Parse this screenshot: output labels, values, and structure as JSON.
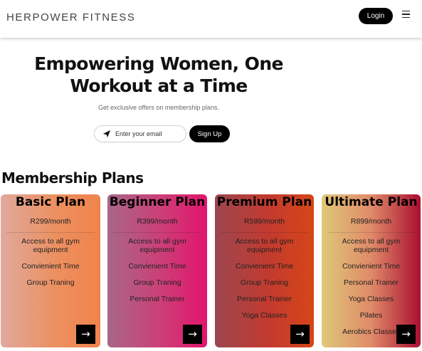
{
  "nav": {
    "brand": "HERPOWER FITNESS",
    "login_label": "Login",
    "menu_icon": "hamburger-menu-icon"
  },
  "hero": {
    "title": "Empowering Women, One Workout at a Time",
    "subtitle": "Get exclusive offers on membership plans.",
    "email_placeholder": "Enter your email",
    "send_icon": "paper-plane-icon",
    "signup_label": "Sign Up"
  },
  "membership": {
    "title": "Membership Plans",
    "plans": [
      {
        "name": "Basic Plan",
        "price": "R299/month",
        "features": [
          "Access to all gym equipment",
          "Convienient Time",
          "Group Traning"
        ],
        "arrow": "→"
      },
      {
        "name": "Beginner Plan",
        "price": "R399/month",
        "features": [
          "Access to all gym equipment",
          "Convienient Time",
          "Group Traning",
          "Personal Trainer"
        ],
        "arrow": "→"
      },
      {
        "name": "Premium Plan",
        "price": "R599/month",
        "features": [
          "Access to all gym equipment",
          "Convienient Time",
          "Group Traning",
          "Personal Trainer",
          "Yoga Classes"
        ],
        "arrow": "→"
      },
      {
        "name": "Ultimate Plan",
        "price": "R899/month",
        "features": [
          "Access to all gym equipment",
          "Convienient Time",
          "Personal Trainer",
          "Yoga Classes",
          "Pilates",
          "Aerobics Classes"
        ],
        "arrow": "→"
      }
    ]
  }
}
